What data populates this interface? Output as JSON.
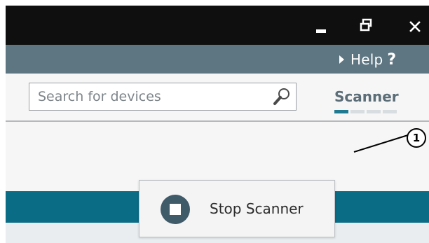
{
  "helpbar": {
    "help_label": "Help",
    "help_symbol": "?"
  },
  "search": {
    "placeholder": "Search for devices",
    "value": ""
  },
  "scanner": {
    "tab_label": "Scanner",
    "progress_segments": 4,
    "active_segments": 1
  },
  "popup": {
    "stop_label": "Stop Scanner"
  },
  "callout": {
    "number": "1"
  },
  "colors": {
    "titlebar": "#0f0f0f",
    "helpbar": "#5e7682",
    "accent_teal": "#0a6c85",
    "stop_button": "#3f5a69",
    "scanner_text": "#5b6e78"
  },
  "icons": {
    "minimize": "minimize-icon",
    "restore": "restore-icon",
    "close": "close-icon",
    "help_arrow": "triangle-right-icon",
    "search": "magnifier-icon",
    "stop": "stop-icon"
  }
}
